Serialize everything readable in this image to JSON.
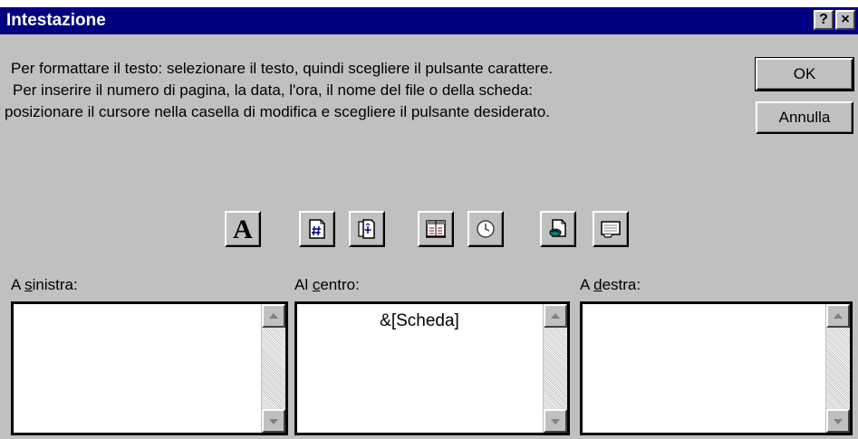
{
  "window": {
    "title": "Intestazione",
    "help_label": "?",
    "close_label": "×"
  },
  "instructions": [
    "Per formattare il testo: selezionare il testo, quindi scegliere il pulsante carattere.",
    "Per inserire il numero di pagina, la data, l'ora, il nome del file o della scheda:",
    "posizionare il cursore nella casella di modifica e scegliere il pulsante desiderato."
  ],
  "buttons": {
    "ok": "OK",
    "cancel": "Annulla"
  },
  "toolbar": {
    "font_glyph": "A",
    "icons": [
      "font-icon",
      "page-number-icon",
      "total-pages-icon",
      "date-icon",
      "time-icon",
      "filename-icon",
      "sheet-name-icon"
    ]
  },
  "sections": {
    "left": {
      "label_pre": "A ",
      "label_access": "s",
      "label_post": "inistra:",
      "value": ""
    },
    "center": {
      "label_pre": "Al ",
      "label_access": "c",
      "label_post": "entro:",
      "value": "&[Scheda]"
    },
    "right": {
      "label_pre": "A ",
      "label_access": "d",
      "label_post": "estra:",
      "value": ""
    }
  },
  "colors": {
    "titlebar": "#000080",
    "face": "#c0c0c0"
  }
}
